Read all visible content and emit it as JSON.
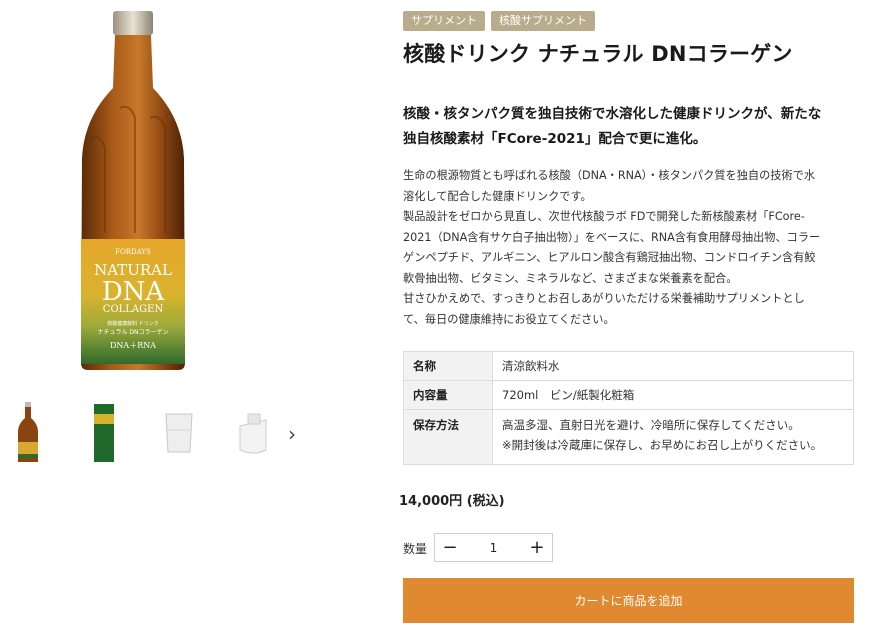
{
  "product": {
    "tags": [
      "サプリメント",
      "核酸サプリメント"
    ],
    "title": "核酸ドリンク ナチュラル DNコラーゲン",
    "lead": [
      "核酸・核タンパク質を独自技術で水溶化した健康ドリンクが、新たな",
      "独自核酸素材「FCore-2021」配合で更に進化。"
    ],
    "description": [
      "生命の根源物質とも呼ばれる核酸（DNA・RNA）・核タンパク質を独自の技術で水",
      "溶化して配合した健康ドリンクです。",
      "製品設計をゼロから見直し、次世代核酸ラボ FDで開発した新核酸素材「FCore-",
      "2021（DNA含有サケ白子抽出物）」をベースに、RNA含有食用酵母抽出物、コラー",
      "ゲンペプチド、アルギニン、ヒアルロン酸含有鶏冠抽出物、コンドロイチン含有鮫",
      "軟骨抽出物、ビタミン、ミネラルなど、さまざまな栄養素を配合。",
      "甘さひかえめで、すっきりとお召しあがりいただける栄養補助サプリメントとし",
      "て、毎日の健康維持にお役立てください。"
    ],
    "label": {
      "brand": "FORDAYS",
      "line1": "NATURAL",
      "line2": "DNA",
      "line3": "COLLAGEN",
      "small1": "核酸健康飲料 ドリンク",
      "small2": "ナチュラル DNコラーゲン",
      "small3": "DNA＋RNA"
    },
    "colors": {
      "tag": "#b8ac8c",
      "cart": "#df8a31",
      "bottle": "#8a4410"
    }
  },
  "specs": [
    {
      "key": "名称",
      "value": [
        "清涼飲料水"
      ]
    },
    {
      "key": "内容量",
      "value": [
        "720ml　ビン/紙製化粧箱"
      ]
    },
    {
      "key": "保存方法",
      "value": [
        "高温多湿、直射日光を避け、冷暗所に保存してください。",
        "※開封後は冷蔵庫に保存し、お早めにお召し上がりください。"
      ]
    }
  ],
  "price": "14,000円 (税込)",
  "quantity": {
    "label": "数量",
    "value": "1",
    "minus": "−",
    "plus": "+"
  },
  "cart": {
    "label": "カートに商品を追加"
  },
  "gallery": {
    "next_icon": "chevron-right-icon"
  }
}
